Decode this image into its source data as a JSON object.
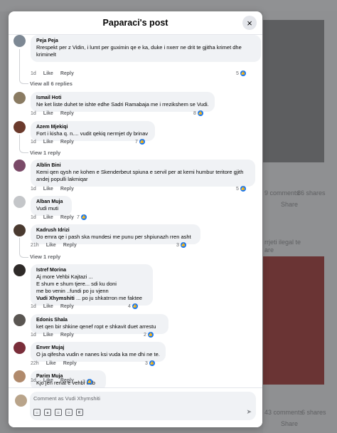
{
  "modal": {
    "title": "Paparaci's post",
    "close_icon": "×"
  },
  "comments": [
    {
      "id": "peja",
      "author": "Peja Peja",
      "lines": [
        "Rrespekt per z Vidin, i lumt per guximin qe e ka, duke i nxerr ne drit te gjitha krimet dhe",
        "kriminelt"
      ],
      "time": "1d",
      "like": "Like",
      "reply": "Reply",
      "count": "5"
    },
    {
      "id": "ismail",
      "author": "Ismail Hoti",
      "lines": [
        "Ne ket liste duhet te ishte edhe Sadri Ramabaja me i rrezikshem se Vudi."
      ],
      "time": "1d",
      "like": "Like",
      "reply": "Reply",
      "count": "8"
    },
    {
      "id": "azem",
      "author": "Azem Mjekiqi",
      "lines": [
        "Fort i kisha q. n.... vudit qekiq nermjet dy brinav"
      ],
      "time": "1d",
      "like": "Like",
      "reply": "Reply",
      "count": "7"
    },
    {
      "id": "alblin",
      "author": "Alblin Bini",
      "lines": [
        "Kemi qen qysh ne kohen e Skenderbeut spiuna e servil per at kemi humbur teritore gjith",
        "andej populli lakmiqar"
      ],
      "time": "1d",
      "like": "Like",
      "reply": "Reply",
      "count": "5"
    },
    {
      "id": "alban",
      "author": "Alban Muja",
      "lines": [
        "Vudi muti"
      ],
      "time": "1d",
      "like": "Like",
      "reply": "Reply",
      "count": "7"
    },
    {
      "id": "kadrush",
      "author": "Kadrush Idrizi",
      "lines": [
        "Do emra qe i pash ska mundesi me punu per shpiunazh rren asht"
      ],
      "time": "21h",
      "like": "Like",
      "reply": "Reply",
      "count": "3"
    },
    {
      "id": "istref",
      "author": "Istref Morina",
      "lines": [
        "Aj more Vehbi Kajtazi ...",
        "E shum e shum tjere... sdi ku doni",
        "me bo venin ..fundi po ju vjenn"
      ],
      "bold_name": "Vudi Xhymshiti",
      "bold_rest": " ... po ju shkatrron me faktee",
      "time": "1d",
      "like": "Like",
      "reply": "Reply",
      "count": "4"
    },
    {
      "id": "edonis",
      "author": "Edonis Shala",
      "lines": [
        "ket qen bir shkine qenef ropt e shkavit duet arrestu"
      ],
      "time": "1d",
      "like": "Like",
      "reply": "Reply",
      "count": "2"
    },
    {
      "id": "enver",
      "author": "Enver Mujaj",
      "lines": [
        "O ja qifesha vudin e nanes ksi vuda ka me dhi ne te."
      ],
      "time": "22h",
      "like": "Like",
      "reply": "Reply",
      "count": "3"
    },
    {
      "id": "parim",
      "author": "Parim Muja",
      "lines": [
        "Kjo jen renat e vehbi udb"
      ],
      "time": "1d",
      "like": "Like",
      "reply": "Reply",
      "count": "3"
    }
  ],
  "view_links": {
    "all_replies": "View all 6 replies",
    "reply1": "View 1 reply",
    "reply2": "View 1 reply"
  },
  "footer": {
    "placeholder": "Comment as Vudi Xhymshiti"
  },
  "background": {
    "comments1": "9 comments",
    "shares1": "86 shares",
    "share1": "Share",
    "snippet1": "rrjeti ilegal te",
    "snippet2": "are",
    "comments2": "43 comments",
    "shares2": "6 shares",
    "share2": "Share"
  },
  "colors": {
    "accent": "#1877f2",
    "bubble": "#f0f2f5"
  }
}
